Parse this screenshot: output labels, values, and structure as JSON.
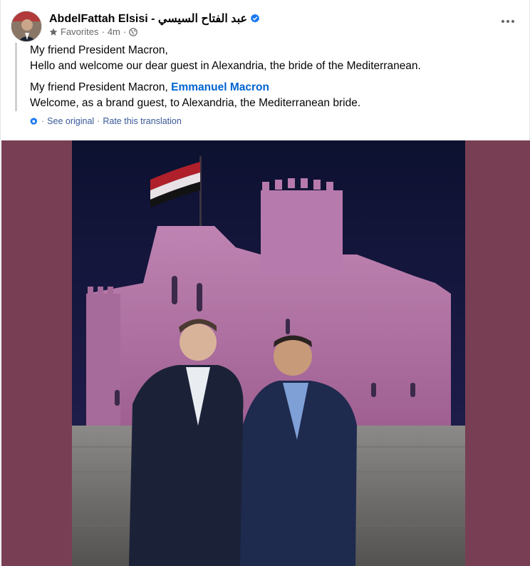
{
  "post": {
    "author": "AbdelFattah Elsisi - عبد الفتاح السيسي",
    "audience_label": "Favorites",
    "separator": "·",
    "time": "4m",
    "translation": {
      "line1": "My friend President Macron,",
      "line2": "Hello and welcome our dear guest in Alexandria, the bride of the Mediterranean."
    },
    "original": {
      "line1_prefix": "My friend President Macron, ",
      "mention": "Emmanuel Macron",
      "line2": "Welcome, as a brand guest, to Alexandria, the Mediterranean bride."
    },
    "links": {
      "see_original": "See original",
      "dot": "·",
      "rate_translation": "Rate this translation"
    }
  },
  "colors": {
    "accent_link": "#0064d1",
    "verified_blue": "#1877f2",
    "photo_background": "#783f54"
  },
  "icons": {
    "verified": "verified-badge-icon",
    "favorites": "star-icon",
    "audience": "globe-icon",
    "translate": "translate-gear-icon",
    "more": "more-options-icon"
  }
}
